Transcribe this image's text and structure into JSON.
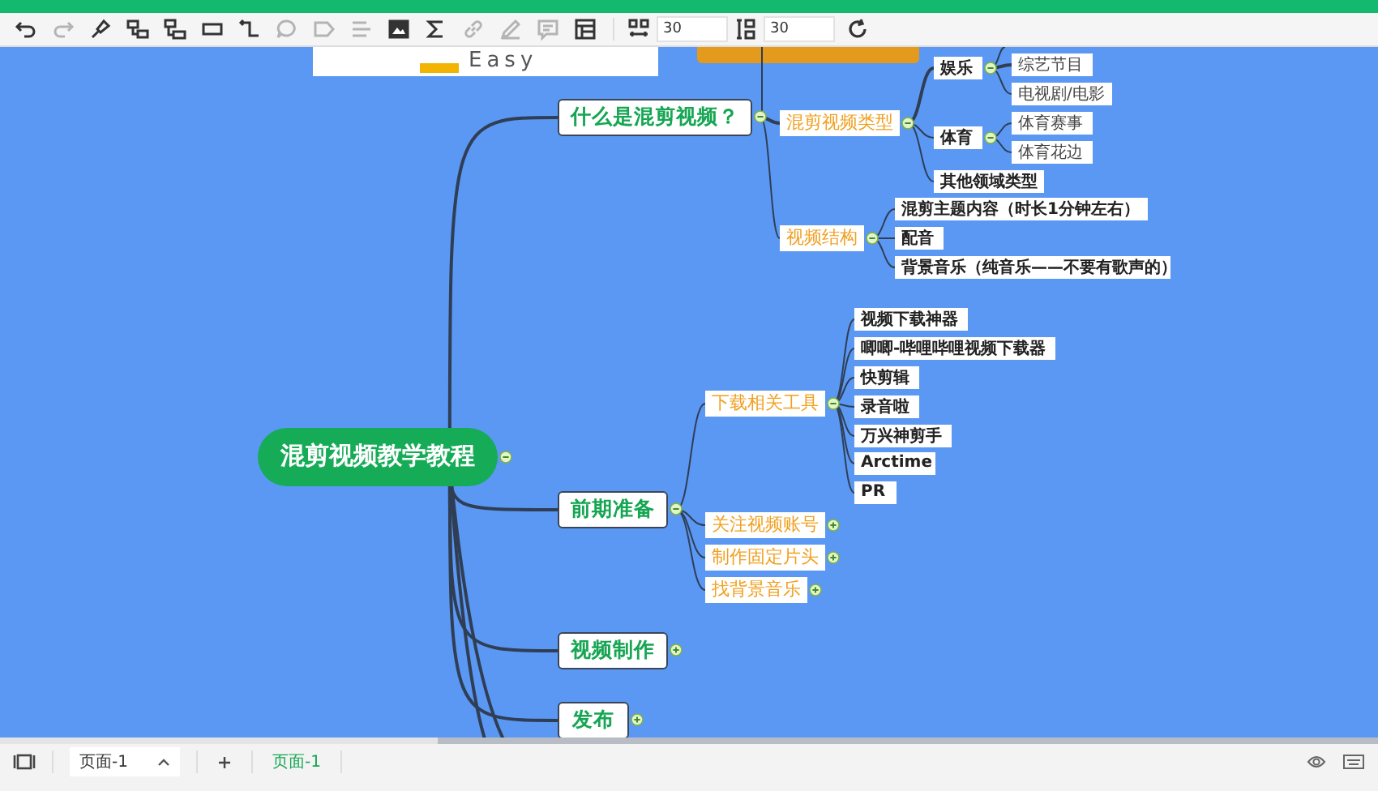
{
  "toolbar": {
    "tools": [
      {
        "kind": "undo",
        "disabled": false
      },
      {
        "kind": "redo",
        "disabled": true
      },
      {
        "kind": "brush",
        "disabled": false
      },
      {
        "kind": "child",
        "disabled": false
      },
      {
        "kind": "sibling",
        "disabled": false
      },
      {
        "kind": "frame",
        "disabled": false
      },
      {
        "kind": "connect",
        "disabled": false
      },
      {
        "kind": "comment",
        "disabled": true
      },
      {
        "kind": "tag",
        "disabled": true
      },
      {
        "kind": "list",
        "disabled": true
      },
      {
        "kind": "image",
        "disabled": false
      },
      {
        "kind": "sigma",
        "disabled": false
      },
      {
        "kind": "link",
        "disabled": true
      },
      {
        "kind": "pencil",
        "disabled": true
      },
      {
        "kind": "note",
        "disabled": true
      },
      {
        "kind": "table",
        "disabled": false
      }
    ],
    "spacing_h": "30",
    "spacing_v": "30"
  },
  "canvas": {
    "banner_text": "Easy",
    "map": {
      "label": "混剪视频教学教程",
      "kind": "root",
      "expanded": true,
      "children": [
        {
          "label": "什么是混剪视频？",
          "kind": "topic",
          "expanded": true,
          "children": [
            {
              "label": "混剪视频类型",
              "kind": "sub",
              "expanded": true,
              "children": [
                {
                  "label": "娱乐",
                  "kind": "group",
                  "expanded": true,
                  "children": [
                    {
                      "label": "综艺节目",
                      "kind": "item"
                    },
                    {
                      "label": "电视剧/电影",
                      "kind": "item"
                    }
                  ]
                },
                {
                  "label": "体育",
                  "kind": "group",
                  "expanded": true,
                  "children": [
                    {
                      "label": "体育赛事",
                      "kind": "item"
                    },
                    {
                      "label": "体育花边",
                      "kind": "item"
                    }
                  ]
                },
                {
                  "label": "其他领域类型",
                  "kind": "group"
                }
              ]
            },
            {
              "label": "视频结构",
              "kind": "sub",
              "expanded": true,
              "children": [
                {
                  "label": "混剪主题内容（时长1分钟左右）",
                  "kind": "group"
                },
                {
                  "label": "配音",
                  "kind": "group"
                },
                {
                  "label": "背景音乐（纯音乐——不要有歌声的）",
                  "kind": "group"
                }
              ]
            }
          ]
        },
        {
          "label": "前期准备",
          "kind": "topic",
          "expanded": true,
          "children": [
            {
              "label": "下载相关工具",
              "kind": "sub",
              "expanded": true,
              "children": [
                {
                  "label": "视频下载神器",
                  "kind": "group"
                },
                {
                  "label": "唧唧-哔哩哔哩视频下载器",
                  "kind": "group"
                },
                {
                  "label": "快剪辑",
                  "kind": "group"
                },
                {
                  "label": "录音啦",
                  "kind": "group"
                },
                {
                  "label": "万兴神剪手",
                  "kind": "group"
                },
                {
                  "label": "Arctime",
                  "kind": "group"
                },
                {
                  "label": "PR",
                  "kind": "group"
                }
              ]
            },
            {
              "label": "关注视频账号",
              "kind": "sub",
              "expanded": false
            },
            {
              "label": "制作固定片头",
              "kind": "sub",
              "expanded": false
            },
            {
              "label": "找背景音乐",
              "kind": "sub",
              "expanded": false
            }
          ]
        },
        {
          "label": "视频制作",
          "kind": "topic",
          "expanded": false
        },
        {
          "label": "发布",
          "kind": "topic",
          "expanded": false
        }
      ]
    }
  },
  "bottom_bar": {
    "page_select": "页面-1",
    "tabs": [
      {
        "label": "页面-1",
        "selected": true
      }
    ]
  }
}
